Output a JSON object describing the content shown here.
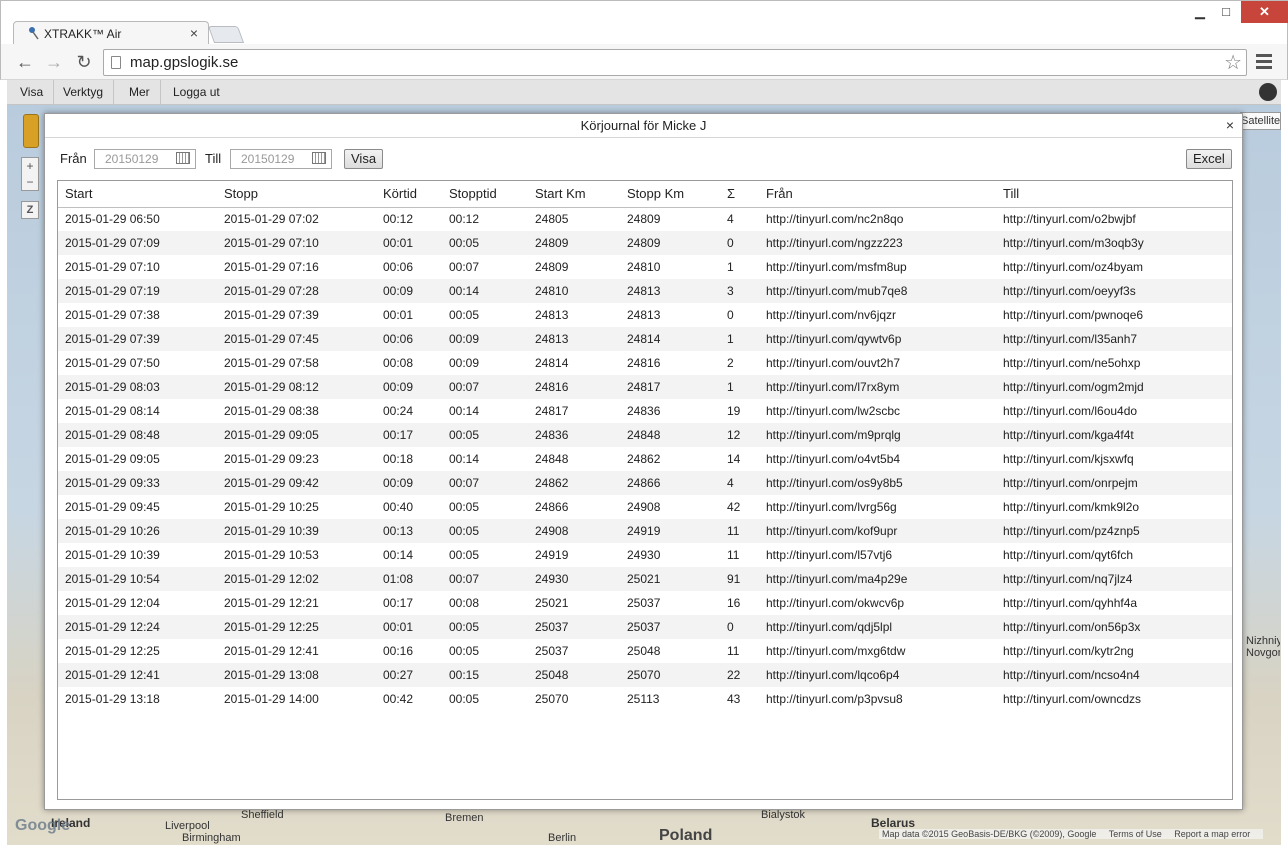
{
  "browser": {
    "tab_title": "XTRAKK™ Air",
    "url": "map.gpslogik.se"
  },
  "app_menu": [
    "Visa",
    "Verktyg",
    "Mer",
    "Logga ut"
  ],
  "map": {
    "satellite_label": "Satellite",
    "google_label": "Google",
    "cities": [
      {
        "name": "Sheffield",
        "cls": ""
      },
      {
        "name": "Liverpool",
        "cls": ""
      },
      {
        "name": "Birmingham",
        "cls": ""
      },
      {
        "name": "Bremen",
        "cls": ""
      },
      {
        "name": "Berlin",
        "cls": ""
      },
      {
        "name": "Poland",
        "cls": "big"
      },
      {
        "name": "Bialystok",
        "cls": ""
      },
      {
        "name": "Belarus",
        "cls": "land"
      },
      {
        "name": "Ireland",
        "cls": "land"
      },
      {
        "name": "Nizhniy Novgorod",
        "cls": ""
      }
    ],
    "attribution": [
      "Map data ©2015 GeoBasis-DE/BKG (©2009), Google",
      "Terms of Use",
      "Report a map error"
    ]
  },
  "dialog": {
    "title": "Körjournal för Micke J",
    "from_label": "Från",
    "to_label": "Till",
    "from_value": "20150129",
    "to_value": "20150129",
    "show_button": "Visa",
    "excel_button": "Excel"
  },
  "table": {
    "columns": [
      "Start",
      "Stopp",
      "Körtid",
      "Stopptid",
      "Start Km",
      "Stopp Km",
      "Σ",
      "Från",
      "Till"
    ],
    "rows": [
      [
        "2015-01-29 06:50",
        "2015-01-29 07:02",
        "00:12",
        "00:12",
        "24805",
        "24809",
        "4",
        "http://tinyurl.com/nc2n8qo",
        "http://tinyurl.com/o2bwjbf"
      ],
      [
        "2015-01-29 07:09",
        "2015-01-29 07:10",
        "00:01",
        "00:05",
        "24809",
        "24809",
        "0",
        "http://tinyurl.com/ngzz223",
        "http://tinyurl.com/m3oqb3y"
      ],
      [
        "2015-01-29 07:10",
        "2015-01-29 07:16",
        "00:06",
        "00:07",
        "24809",
        "24810",
        "1",
        "http://tinyurl.com/msfm8up",
        "http://tinyurl.com/oz4byam"
      ],
      [
        "2015-01-29 07:19",
        "2015-01-29 07:28",
        "00:09",
        "00:14",
        "24810",
        "24813",
        "3",
        "http://tinyurl.com/mub7qe8",
        "http://tinyurl.com/oeyyf3s"
      ],
      [
        "2015-01-29 07:38",
        "2015-01-29 07:39",
        "00:01",
        "00:05",
        "24813",
        "24813",
        "0",
        "http://tinyurl.com/nv6jqzr",
        "http://tinyurl.com/pwnoqe6"
      ],
      [
        "2015-01-29 07:39",
        "2015-01-29 07:45",
        "00:06",
        "00:09",
        "24813",
        "24814",
        "1",
        "http://tinyurl.com/qywtv6p",
        "http://tinyurl.com/l35anh7"
      ],
      [
        "2015-01-29 07:50",
        "2015-01-29 07:58",
        "00:08",
        "00:09",
        "24814",
        "24816",
        "2",
        "http://tinyurl.com/ouvt2h7",
        "http://tinyurl.com/ne5ohxp"
      ],
      [
        "2015-01-29 08:03",
        "2015-01-29 08:12",
        "00:09",
        "00:07",
        "24816",
        "24817",
        "1",
        "http://tinyurl.com/l7rx8ym",
        "http://tinyurl.com/ogm2mjd"
      ],
      [
        "2015-01-29 08:14",
        "2015-01-29 08:38",
        "00:24",
        "00:14",
        "24817",
        "24836",
        "19",
        "http://tinyurl.com/lw2scbc",
        "http://tinyurl.com/l6ou4do"
      ],
      [
        "2015-01-29 08:48",
        "2015-01-29 09:05",
        "00:17",
        "00:05",
        "24836",
        "24848",
        "12",
        "http://tinyurl.com/m9prqlg",
        "http://tinyurl.com/kga4f4t"
      ],
      [
        "2015-01-29 09:05",
        "2015-01-29 09:23",
        "00:18",
        "00:14",
        "24848",
        "24862",
        "14",
        "http://tinyurl.com/o4vt5b4",
        "http://tinyurl.com/kjsxwfq"
      ],
      [
        "2015-01-29 09:33",
        "2015-01-29 09:42",
        "00:09",
        "00:07",
        "24862",
        "24866",
        "4",
        "http://tinyurl.com/os9y8b5",
        "http://tinyurl.com/onrpejm"
      ],
      [
        "2015-01-29 09:45",
        "2015-01-29 10:25",
        "00:40",
        "00:05",
        "24866",
        "24908",
        "42",
        "http://tinyurl.com/lvrg56g",
        "http://tinyurl.com/kmk9l2o"
      ],
      [
        "2015-01-29 10:26",
        "2015-01-29 10:39",
        "00:13",
        "00:05",
        "24908",
        "24919",
        "11",
        "http://tinyurl.com/kof9upr",
        "http://tinyurl.com/pz4znp5"
      ],
      [
        "2015-01-29 10:39",
        "2015-01-29 10:53",
        "00:14",
        "00:05",
        "24919",
        "24930",
        "11",
        "http://tinyurl.com/l57vtj6",
        "http://tinyurl.com/qyt6fch"
      ],
      [
        "2015-01-29 10:54",
        "2015-01-29 12:02",
        "01:08",
        "00:07",
        "24930",
        "25021",
        "91",
        "http://tinyurl.com/ma4p29e",
        "http://tinyurl.com/nq7jlz4"
      ],
      [
        "2015-01-29 12:04",
        "2015-01-29 12:21",
        "00:17",
        "00:08",
        "25021",
        "25037",
        "16",
        "http://tinyurl.com/okwcv6p",
        "http://tinyurl.com/qyhhf4a"
      ],
      [
        "2015-01-29 12:24",
        "2015-01-29 12:25",
        "00:01",
        "00:05",
        "25037",
        "25037",
        "0",
        "http://tinyurl.com/qdj5lpl",
        "http://tinyurl.com/on56p3x"
      ],
      [
        "2015-01-29 12:25",
        "2015-01-29 12:41",
        "00:16",
        "00:05",
        "25037",
        "25048",
        "11",
        "http://tinyurl.com/mxg6tdw",
        "http://tinyurl.com/kytr2ng"
      ],
      [
        "2015-01-29 12:41",
        "2015-01-29 13:08",
        "00:27",
        "00:15",
        "25048",
        "25070",
        "22",
        "http://tinyurl.com/lqco6p4",
        "http://tinyurl.com/ncso4n4"
      ],
      [
        "2015-01-29 13:18",
        "2015-01-29 14:00",
        "00:42",
        "00:05",
        "25070",
        "25113",
        "43",
        "http://tinyurl.com/p3pvsu8",
        "http://tinyurl.com/owncdzs"
      ]
    ]
  }
}
